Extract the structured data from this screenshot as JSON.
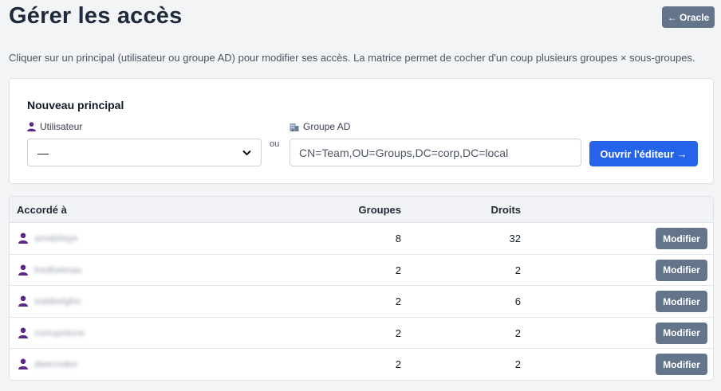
{
  "page": {
    "title": "Gérer les accès",
    "back_label": "← Oracle",
    "description": "Cliquer sur un principal (utilisateur ou groupe AD) pour modifier ses accès. La matrice permet de cocher d'un coup plusieurs groupes × sous-groupes."
  },
  "new_principal": {
    "title": "Nouveau principal",
    "user_label": "Utilisateur",
    "user_select_value": "—",
    "or_label": "ou",
    "group_label": "Groupe AD",
    "group_placeholder": "CN=Team,OU=Groups,DC=corp,DC=local",
    "open_editor_label": "Ouvrir l'éditeur →"
  },
  "table": {
    "headers": {
      "granted_to": "Accordé à",
      "groups": "Groupes",
      "rights": "Droits"
    },
    "rows": [
      {
        "name": "amabilaye",
        "groups": "8",
        "rights": "32",
        "action": "Modifier"
      },
      {
        "name": "fredbelmas",
        "groups": "2",
        "rights": "2",
        "action": "Modifier"
      },
      {
        "name": "isabbelgho",
        "groups": "2",
        "rights": "6",
        "action": "Modifier"
      },
      {
        "name": "romupolone",
        "groups": "2",
        "rights": "2",
        "action": "Modifier"
      },
      {
        "name": "dwecodes",
        "groups": "2",
        "rights": "2",
        "action": "Modifier"
      }
    ]
  },
  "icons": {
    "user": "person-icon",
    "group": "building-icon",
    "select": "chevron-down-icon"
  },
  "colors": {
    "primary": "#2563eb",
    "secondary": "#64748b",
    "user_icon": "#5b2a86"
  }
}
